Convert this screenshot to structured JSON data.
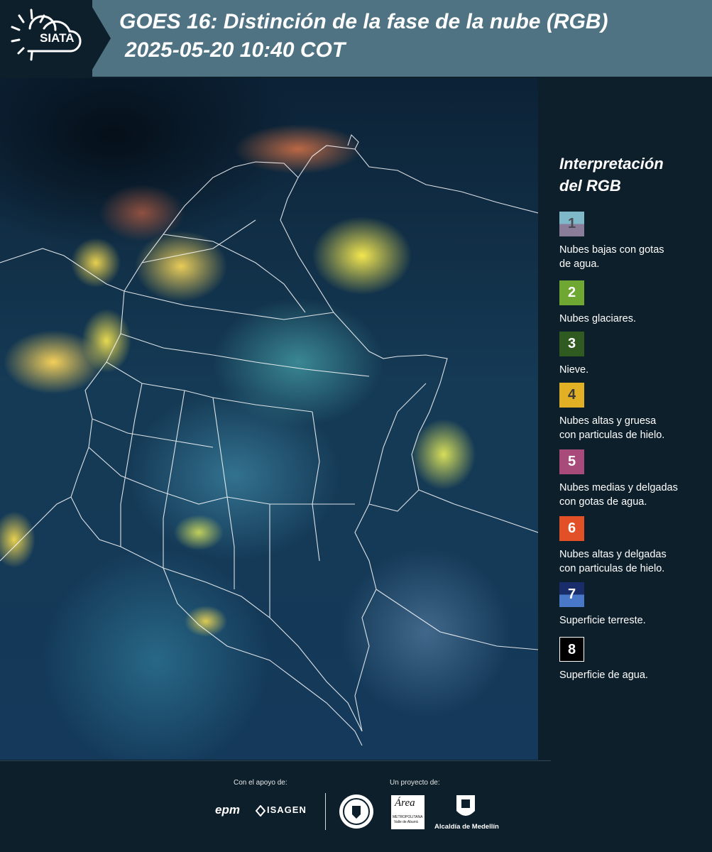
{
  "header": {
    "logo_text": "SIATA",
    "title_line1": "GOES 16: Distinción de la fase de la nube (RGB)",
    "title_line2": "2025-05-20 10:40 COT"
  },
  "legend": {
    "title_line1": "Interpretación",
    "title_line2": "del RGB",
    "items": [
      {
        "number": "1",
        "label_line1": "Nubes bajas con gotas",
        "label_line2": "de agua.",
        "color_top": "#7fb8c9",
        "color_bottom": "#8a7d9a",
        "number_color": "#4a4a55"
      },
      {
        "number": "2",
        "label_line1": "Nubes glaciares.",
        "label_line2": "",
        "color_top": "#6ea832",
        "color_bottom": "#6ea832",
        "number_color": "#ffffff"
      },
      {
        "number": "3",
        "label_line1": "Nieve.",
        "label_line2": "",
        "color_top": "#2f5a20",
        "color_bottom": "#2f5a20",
        "number_color": "#ffffff"
      },
      {
        "number": "4",
        "label_line1": "Nubes altas y gruesa",
        "label_line2": "con particulas de hielo.",
        "color_top": "#e2b024",
        "color_bottom": "#e2b024",
        "number_color": "#3a3a3a"
      },
      {
        "number": "5",
        "label_line1": "Nubes medias y delgadas",
        "label_line2": "con gotas de agua.",
        "color_top": "#a84a7a",
        "color_bottom": "#a84a7a",
        "number_color": "#ffffff"
      },
      {
        "number": "6",
        "label_line1": "Nubes altas y delgadas",
        "label_line2": "con particulas de hielo.",
        "color_top": "#e25028",
        "color_bottom": "#e25028",
        "number_color": "#ffffff"
      },
      {
        "number": "7",
        "label_line1": "Superficie terreste.",
        "label_line2": "",
        "color_top": "#1a2d6b",
        "color_bottom": "#4a78c8",
        "number_color": "#ffffff"
      },
      {
        "number": "8",
        "label_line1": "Superficie de agua.",
        "label_line2": "",
        "color_top": "#000000",
        "color_bottom": "#000000",
        "number_color": "#ffffff"
      }
    ]
  },
  "footer": {
    "support_label": "Con el apoyo de:",
    "project_label": "Un proyecto de:",
    "sponsor1": "epm",
    "sponsor2": "ISAGEN",
    "area_logo_text": "Área",
    "area_logo_sub1": "METROPOLITANA",
    "area_logo_sub2": "Valle de Aburrá",
    "alcaldia_label": "Alcaldía de Medellín"
  }
}
